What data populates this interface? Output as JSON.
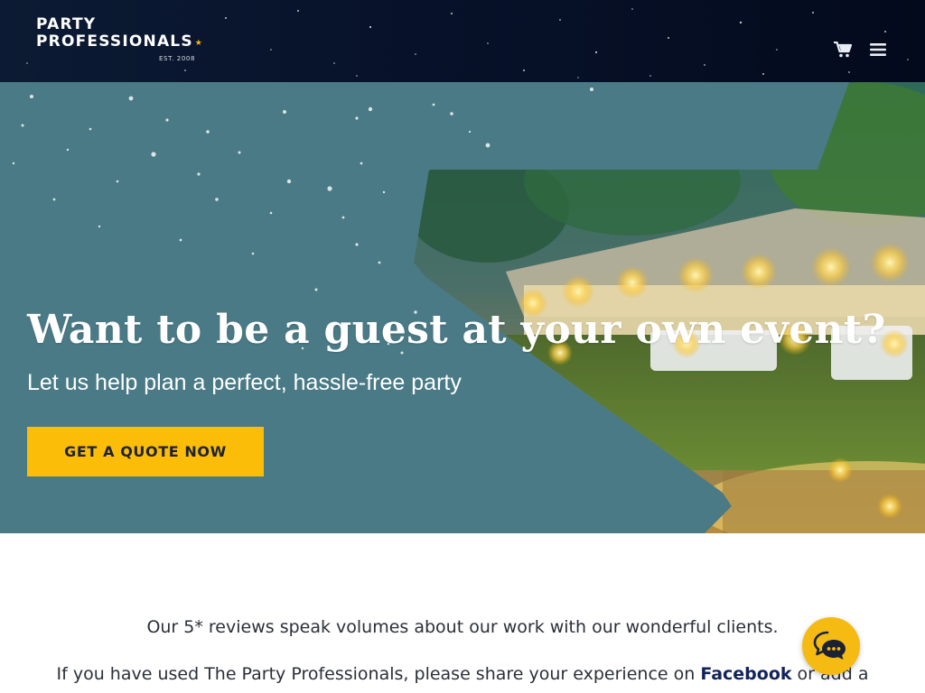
{
  "brand": {
    "line1": "PARTY",
    "line2": "PROFESSIONALS",
    "established": "EST. 2008",
    "accent_color": "#f5b912"
  },
  "header": {
    "cart_icon": "shopping-cart-icon",
    "menu_icon": "hamburger-menu-icon"
  },
  "hero": {
    "title": "Want to be a guest at your own event?",
    "subtitle": "Let us help plan a perfect, hassle-free party",
    "cta_label": "GET A QUOTE NOW",
    "cta_color": "#fbbd08",
    "overlay_color": "#4a7a86"
  },
  "content": {
    "reviews_line": "Our 5* reviews speak volumes about our work with our wonderful clients.",
    "share_prefix": "If you have used The Party Professionals, please share your experience on ",
    "share_link": "Facebook",
    "share_suffix": " or add a"
  },
  "chat": {
    "icon": "chat-bubbles-icon",
    "color": "#f6bb12"
  }
}
